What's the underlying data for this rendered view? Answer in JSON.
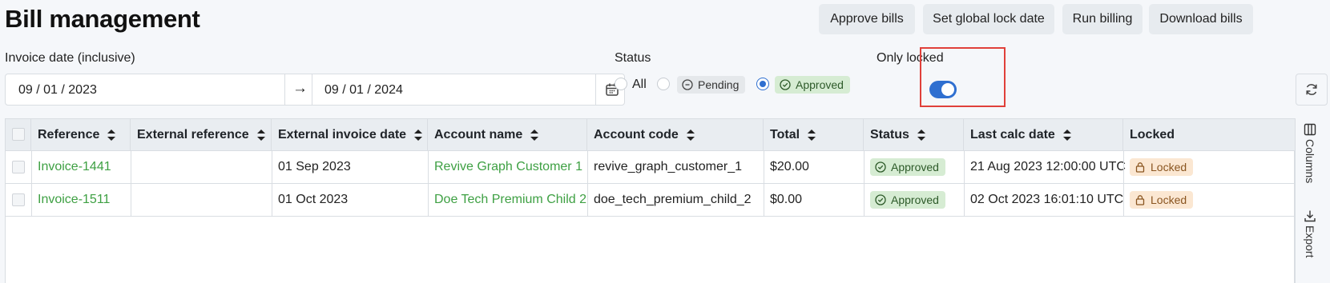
{
  "page": {
    "title": "Bill management"
  },
  "header_actions": {
    "approve": "Approve bills",
    "lock_date": "Set global lock date",
    "run_billing": "Run billing",
    "download": "Download bills"
  },
  "filters": {
    "date_label": "Invoice date (inclusive)",
    "date_from": "09 / 01 / 2023",
    "arrow": "→",
    "date_to": "09 / 01 / 2024",
    "status_label": "Status",
    "status_options": [
      {
        "label": "All",
        "selected": false
      },
      {
        "label": "Pending",
        "selected": false
      },
      {
        "label": "Approved",
        "selected": true
      }
    ],
    "only_locked_label": "Only locked",
    "only_locked_on": true
  },
  "table": {
    "headers": [
      "Reference",
      "External reference",
      "External invoice date",
      "Account name",
      "Account code",
      "Total",
      "Status",
      "Last calc date",
      "Locked"
    ],
    "rows": [
      {
        "reference": "Invoice-1441",
        "external_reference": "",
        "external_invoice_date": "01 Sep 2023",
        "account_name": "Revive Graph Customer 1",
        "account_code": "revive_graph_customer_1",
        "total": "$20.00",
        "status": "Approved",
        "last_calc_date": "21 Aug 2023 12:00:00 UTC",
        "locked": "Locked"
      },
      {
        "reference": "Invoice-1511",
        "external_reference": "",
        "external_invoice_date": "01 Oct 2023",
        "account_name": "Doe Tech Premium Child 2",
        "account_code": "doe_tech_premium_child_2",
        "total": "$0.00",
        "status": "Approved",
        "last_calc_date": "02 Oct 2023 16:01:10 UTC",
        "locked": "Locked"
      }
    ]
  },
  "side_panel": {
    "columns": "Columns",
    "export": "Export"
  },
  "colors": {
    "accent": "#2f6fd0",
    "link": "#3ea043",
    "highlight": "#e0403a"
  }
}
